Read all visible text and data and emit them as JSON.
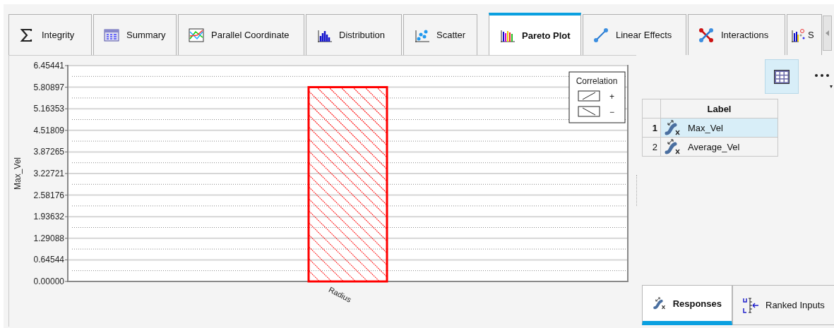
{
  "tabs": [
    {
      "label": "Integrity",
      "selected": false
    },
    {
      "label": "Summary",
      "selected": false
    },
    {
      "label": "Parallel Coordinate",
      "selected": false
    },
    {
      "label": "Distribution",
      "selected": false
    },
    {
      "label": "Scatter",
      "selected": false
    },
    {
      "label": "Pareto Plot",
      "selected": true
    },
    {
      "label": "Linear Effects",
      "selected": false
    },
    {
      "label": "Interactions",
      "selected": false
    },
    {
      "label": "S",
      "selected": false
    }
  ],
  "pareto": {
    "bar_negative_correlation": true,
    "chart_data": {
      "type": "bar",
      "ylabel": "Max_Vel",
      "categories": [
        "Radius"
      ],
      "grid": true,
      "series": [
        {
          "color": "#ff0000",
          "values": [
            5.81
          ]
        }
      ],
      "ylim": [
        0,
        6.45441
      ],
      "yticks": [
        {
          "value": 0,
          "label": "0.00000"
        },
        {
          "value": 0.64544,
          "label": "0.64544"
        },
        {
          "value": 1.29088,
          "label": "1.29088"
        },
        {
          "value": 1.93632,
          "label": "1.93632"
        },
        {
          "value": 2.58176,
          "label": "2.58176"
        },
        {
          "value": 3.22721,
          "label": "3.22721"
        },
        {
          "value": 3.87265,
          "label": "3.87265"
        },
        {
          "value": 4.51809,
          "label": "4.51809"
        },
        {
          "value": 5.16353,
          "label": "5.16353"
        },
        {
          "value": 5.80897,
          "label": "5.80897"
        },
        {
          "value": 6.45441,
          "label": "6.45441"
        }
      ]
    },
    "legend": {
      "title": "Correlation",
      "items": [
        {
          "kind": "positive",
          "label": "+"
        },
        {
          "kind": "negative",
          "label": "−"
        }
      ]
    }
  },
  "table": {
    "columns": [
      "Label"
    ],
    "rows": [
      {
        "index": "1",
        "label": "Max_Vel",
        "selected": true
      },
      {
        "index": "2",
        "label": "Average_Vel",
        "selected": false
      }
    ]
  },
  "bottom_tabs": [
    {
      "label": "Responses",
      "selected": true
    },
    {
      "label": "Ranked Inputs",
      "selected": false
    }
  ]
}
